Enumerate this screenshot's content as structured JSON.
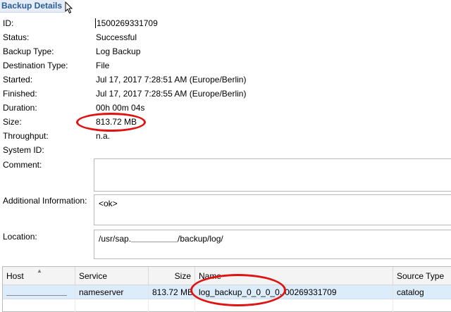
{
  "section_title": "Backup Details",
  "details": {
    "id": {
      "label": "ID:",
      "value": "1500269331709"
    },
    "status": {
      "label": "Status:",
      "value": "Successful"
    },
    "backup_type": {
      "label": "Backup Type:",
      "value": "Log Backup"
    },
    "destination_type": {
      "label": "Destination Type:",
      "value": "File"
    },
    "started": {
      "label": "Started:",
      "value": "Jul 17, 2017 7:28:51 AM (Europe/Berlin)"
    },
    "finished": {
      "label": "Finished:",
      "value": "Jul 17, 2017 7:28:55 AM (Europe/Berlin)"
    },
    "duration": {
      "label": "Duration:",
      "value": "00h 00m 04s"
    },
    "size": {
      "label": "Size:",
      "value": "813.72 MB"
    },
    "throughput": {
      "label": "Throughput:",
      "value": "n.a."
    },
    "system_id": {
      "label": "System ID:",
      "value": ""
    },
    "comment": {
      "label": "Comment:",
      "value": ""
    },
    "additional_information": {
      "label": "Additional Information:",
      "value": "<ok>"
    },
    "location": {
      "label": "Location:",
      "prefix": "/usr/sap.",
      "suffix": "/backup/log/"
    }
  },
  "table": {
    "columns": [
      "Host",
      "Service",
      "Size",
      "Name",
      "Source Type"
    ],
    "rows": [
      {
        "host": "",
        "service": "nameserver",
        "size": "813.72 MB",
        "name_start": "log_backup_0_0_0_0.",
        "name_end": "00269331709",
        "source_type": "catalog"
      }
    ]
  },
  "colors": {
    "title": "#2b5c9a",
    "selected_row": "#ddecfb",
    "highlight_ring": "#e01313"
  }
}
